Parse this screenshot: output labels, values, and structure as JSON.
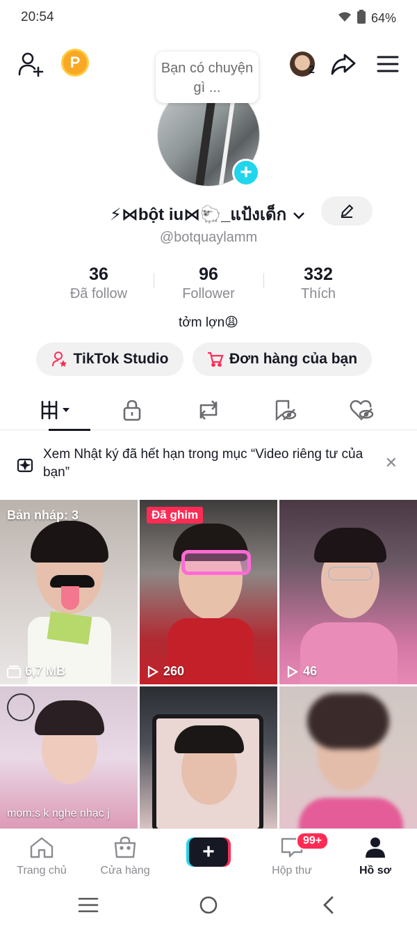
{
  "status": {
    "time": "20:54",
    "battery": "64%"
  },
  "top": {
    "story_prompt": "Bạn có chuyện gì ...",
    "coin_letter": "P",
    "friend_count": "2"
  },
  "profile": {
    "display_name": "⚡⋈bột iu⋈🐑_แป้งเด็ก",
    "username": "@botquaylamm",
    "bio": "tởm lợn😩"
  },
  "stats": [
    {
      "value": "36",
      "label": "Đã follow"
    },
    {
      "value": "96",
      "label": "Follower"
    },
    {
      "value": "332",
      "label": "Thích"
    }
  ],
  "actions": {
    "studio": "TikTok Studio",
    "orders": "Đơn hàng của bạn"
  },
  "notice": {
    "text": "Xem Nhật ký đã hết hạn trong mục “Video riêng tư của bạn”"
  },
  "videos": [
    {
      "label": "Bản nháp: 3",
      "foot": "6,7 MB"
    },
    {
      "pin": "Đã ghim",
      "views": "260"
    },
    {
      "views": "46"
    },
    {
      "caption": "mom:s k nghe nhạc j"
    },
    {},
    {}
  ],
  "nav": {
    "home": "Trang chủ",
    "shop": "Cửa hàng",
    "inbox": "Hộp thư",
    "inbox_badge": "99+",
    "profile": "Hồ sơ"
  },
  "colors": {
    "accent": "#fe2c55",
    "cyan": "#20d5ec",
    "text": "#161823",
    "muted": "#8a8b91"
  }
}
